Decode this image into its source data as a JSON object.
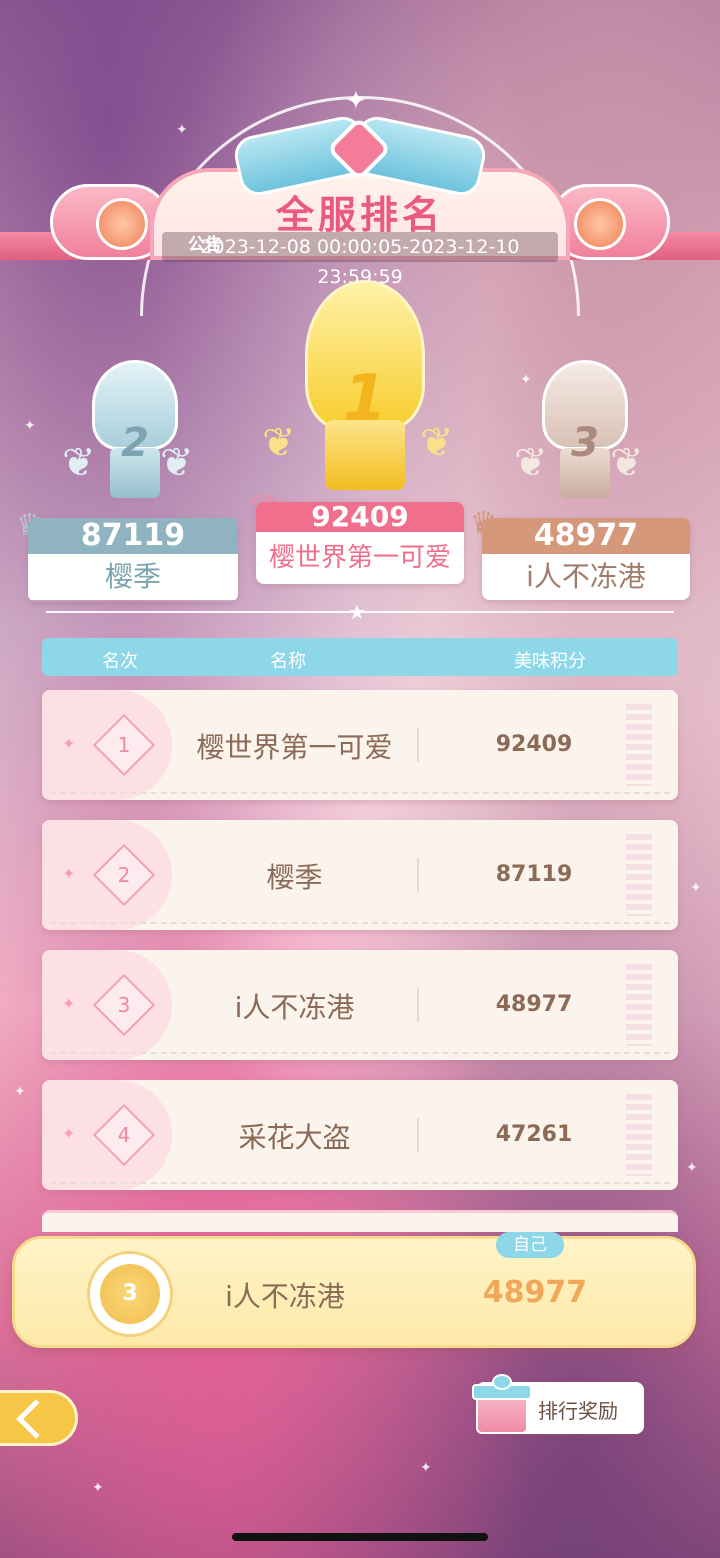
{
  "banner": {
    "title": "全服排名",
    "notice_tag": "公告",
    "date_range": "2023-12-08 00:00:05-2023-12-10 23:59:59"
  },
  "podium": {
    "first": {
      "rank": "1",
      "score": "92409",
      "name": "樱世界第一可爱"
    },
    "second": {
      "rank": "2",
      "score": "87119",
      "name": "樱季"
    },
    "third": {
      "rank": "3",
      "score": "48977",
      "name": "i人不冻港"
    }
  },
  "table_header": {
    "rank": "名次",
    "name": "名称",
    "score": "美味积分"
  },
  "rows": [
    {
      "rank": "1",
      "name": "樱世界第一可爱",
      "score": "92409"
    },
    {
      "rank": "2",
      "name": "樱季",
      "score": "87119"
    },
    {
      "rank": "3",
      "name": "i人不冻港",
      "score": "48977"
    },
    {
      "rank": "4",
      "name": "采花大盗",
      "score": "47261"
    }
  ],
  "self": {
    "tag": "自己",
    "rank": "3",
    "name": "i人不冻港",
    "score": "48977"
  },
  "reward_button": {
    "label": "排行奖励",
    "icon": "gift-icon"
  },
  "back_button": {
    "icon": "back-arrow-icon"
  },
  "colors": {
    "title_pink": "#e95a7c",
    "gold_card": "#ef6f8d",
    "silver_card": "#8fb3c0",
    "bronze_card": "#d6987a",
    "header_blue": "#8ed7e9",
    "self_score": "#f2a65a"
  }
}
